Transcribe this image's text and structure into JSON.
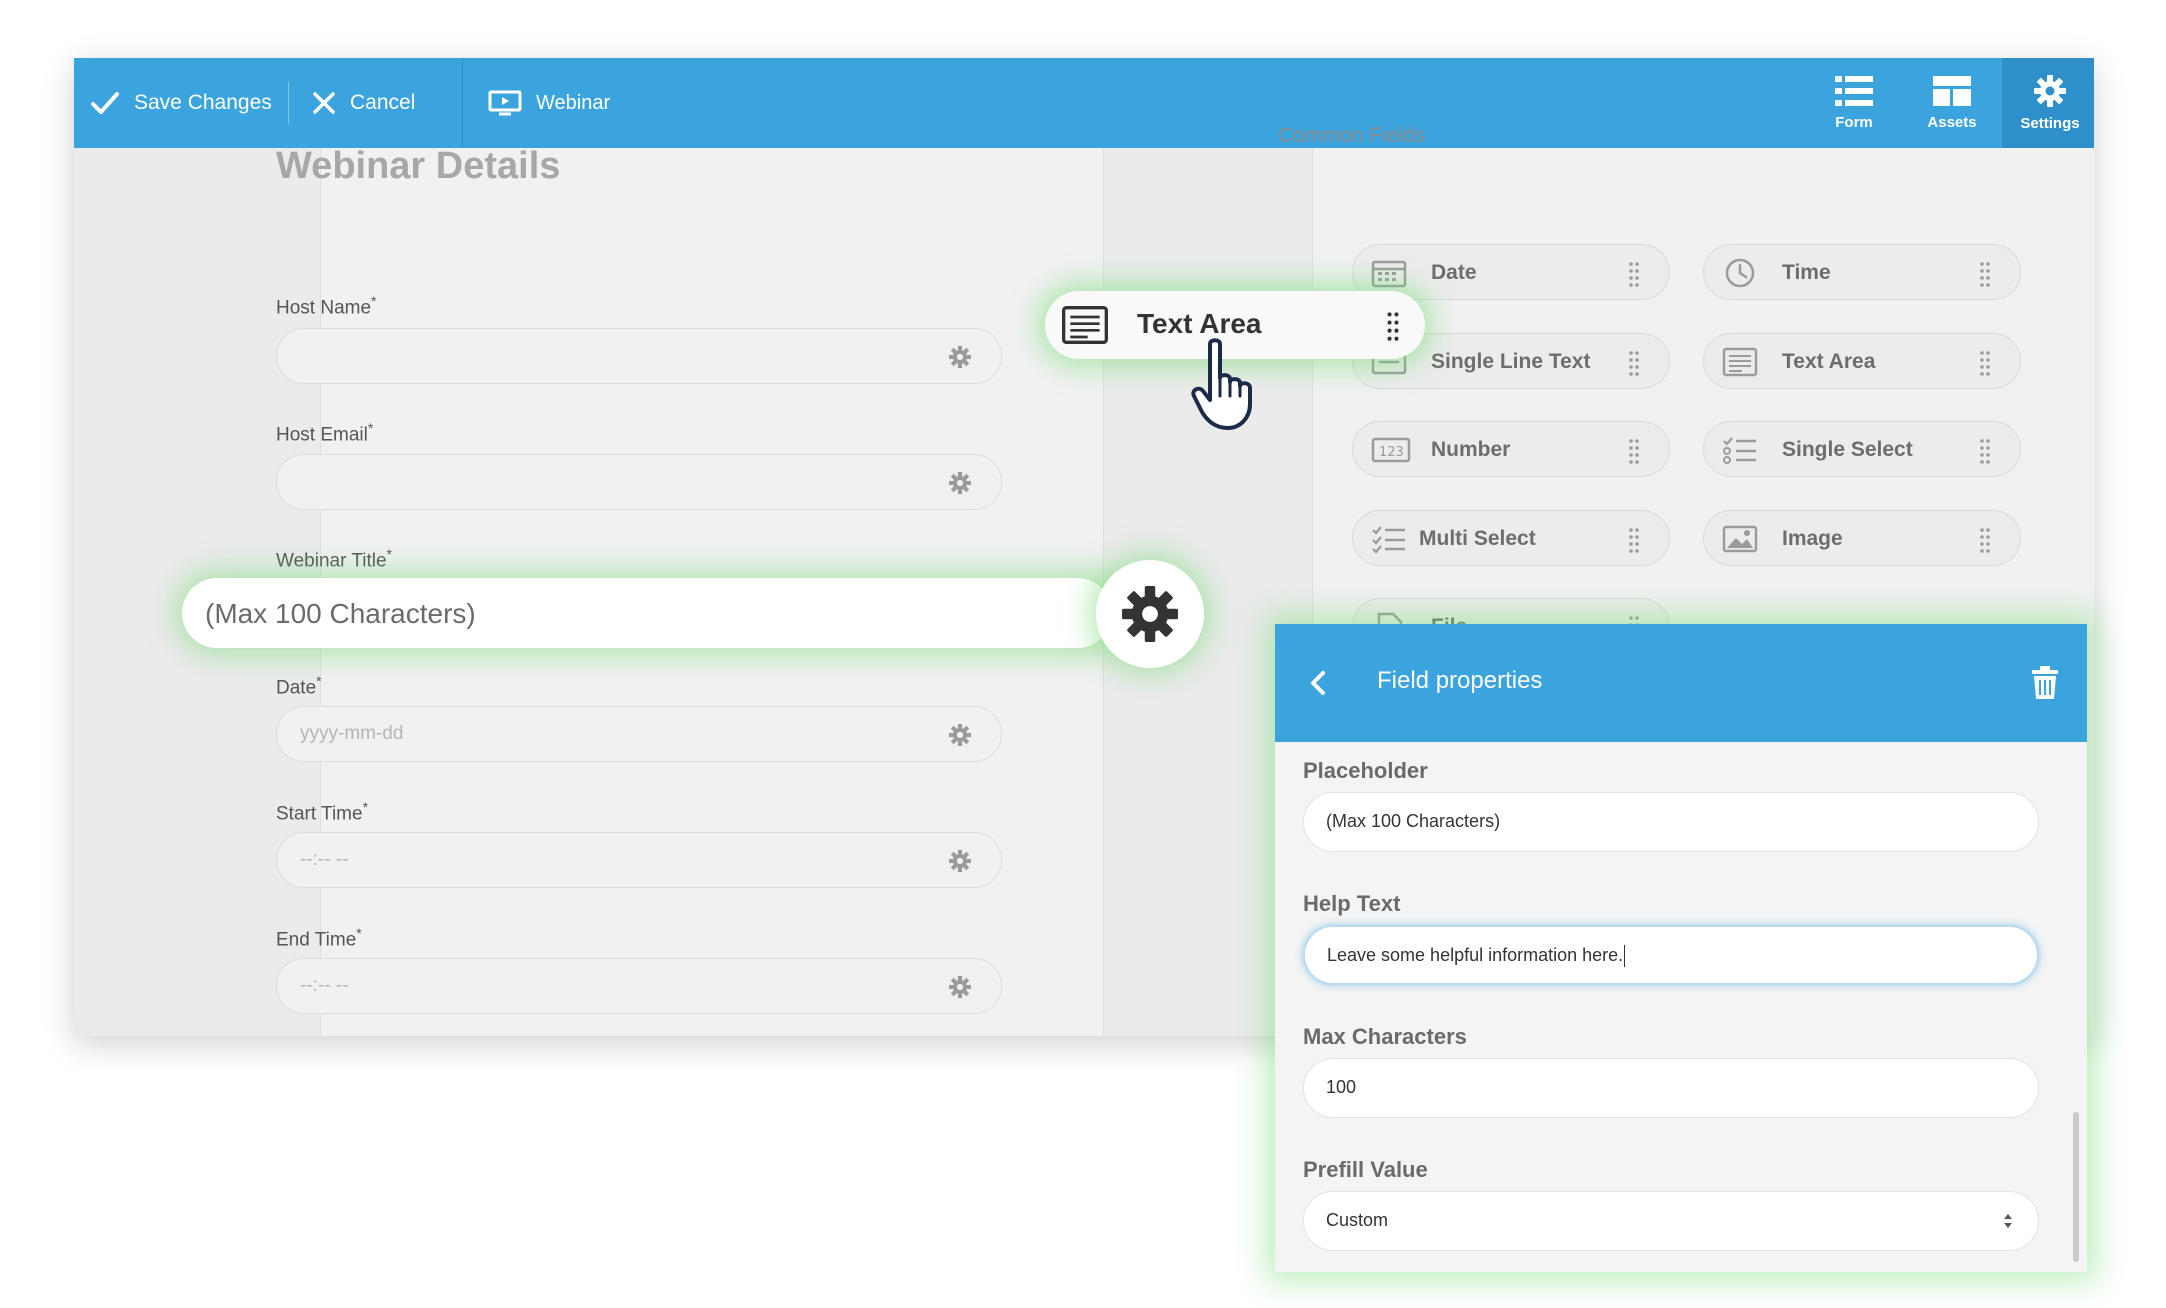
{
  "toolbar": {
    "save_label": "Save Changes",
    "cancel_label": "Cancel",
    "form_name": "Webinar",
    "tabs": [
      {
        "label": "Form",
        "icon": "list-icon"
      },
      {
        "label": "Assets",
        "icon": "layout-icon"
      },
      {
        "label": "Settings",
        "icon": "gear-icon"
      }
    ],
    "active_tab": "Settings"
  },
  "form": {
    "title": "Webinar Details",
    "fields": [
      {
        "label": "Host Name",
        "required": "*",
        "placeholder": ""
      },
      {
        "label": "Host Email",
        "required": "*",
        "placeholder": ""
      },
      {
        "label": "Webinar Title",
        "required": "*",
        "placeholder": "(Max 100 Characters)"
      },
      {
        "label": "Date",
        "required": "*",
        "placeholder": "yyyy-mm-dd"
      },
      {
        "label": "Start Time",
        "required": "*",
        "placeholder": "--:-- --"
      },
      {
        "label": "End Time",
        "required": "*",
        "placeholder": "--:-- --"
      }
    ]
  },
  "common_fields": {
    "title": "Common Fields",
    "items": [
      {
        "label": "Date",
        "icon": "calendar-icon"
      },
      {
        "label": "Time",
        "icon": "clock-icon"
      },
      {
        "label": "Single Line Text",
        "icon": "text-line-icon"
      },
      {
        "label": "Text Area",
        "icon": "text-area-icon"
      },
      {
        "label": "Number",
        "icon": "number-icon"
      },
      {
        "label": "Single Select",
        "icon": "single-select-icon"
      },
      {
        "label": "Multi Select",
        "icon": "multi-select-icon"
      },
      {
        "label": "Image",
        "icon": "image-icon"
      },
      {
        "label": "File",
        "icon": "file-icon"
      }
    ]
  },
  "dragging": {
    "label": "Text Area",
    "icon": "text-area-icon"
  },
  "panel": {
    "title": "Field properties",
    "placeholder_label": "Placeholder",
    "placeholder_value": "(Max 100 Characters)",
    "help_label": "Help Text",
    "help_value": "Leave some helpful information here.",
    "max_label": "Max Characters",
    "max_value": "100",
    "prefill_label": "Prefill Value",
    "prefill_value": "Custom"
  },
  "colors": {
    "accent": "#3ba3dd",
    "glow": "#78dc78"
  }
}
